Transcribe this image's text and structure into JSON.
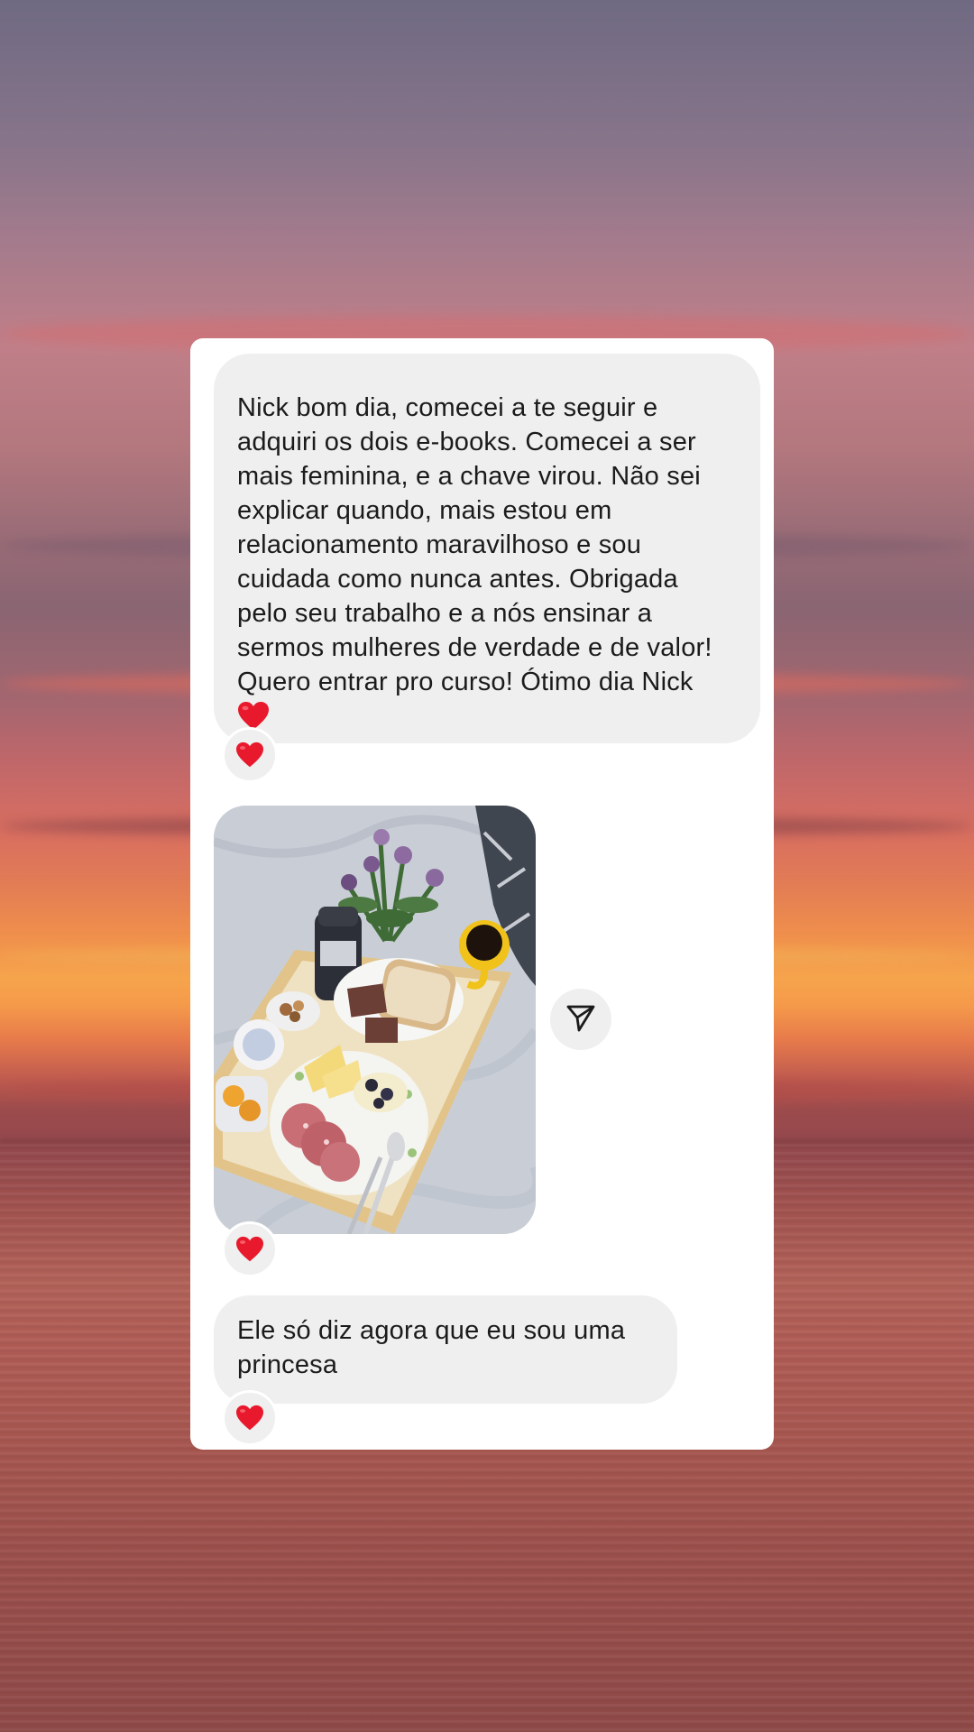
{
  "conversation": {
    "messages": [
      {
        "type": "text",
        "text": "Nick bom dia, comecei a te seguir e\nadquiri os dois e-books. Comecei a ser\nmais feminina, e a chave virou. Não sei\nexplicar quando, mais estou em\nrelacionamento maravilhoso e sou\ncuidada como nunca antes. Obrigada\npelo seu trabalho e a nós ensinar a\nsermos mulheres de verdade e de valor!\nQuero entrar pro curso! Ótimo dia Nick",
        "trailing_emoji": "heart-icon",
        "reaction": "heart-icon"
      },
      {
        "type": "photo",
        "description_icon": "breakfast-tray-photo",
        "reaction": "heart-icon",
        "action": "share-icon"
      },
      {
        "type": "text",
        "text": "Ele só diz agora que eu sou uma\nprincesa",
        "reaction": "heart-icon"
      }
    ]
  },
  "colors": {
    "bubble": "#efefef",
    "card": "#ffffff",
    "text": "#1b1b1b",
    "heart": "#e8192c"
  }
}
